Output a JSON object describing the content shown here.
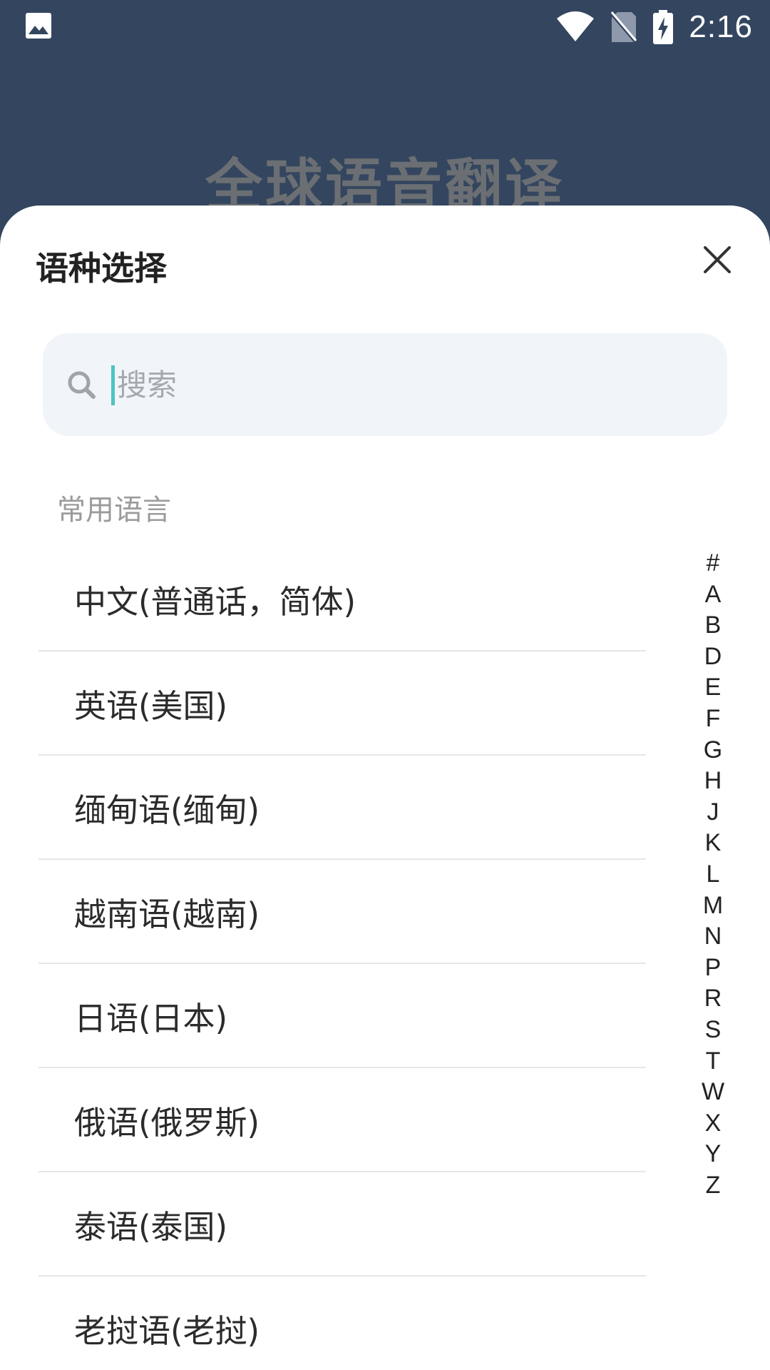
{
  "status_bar": {
    "time": "2:16",
    "icons": [
      "gallery-icon",
      "wifi-icon",
      "no-sim-icon",
      "battery-charging-icon"
    ]
  },
  "background": {
    "app_title": "全球语音翻译"
  },
  "sheet": {
    "title": "语种选择",
    "close_icon": "close-icon",
    "search": {
      "placeholder": "搜索",
      "value": "",
      "icon": "search-icon"
    },
    "section_header": "常用语言",
    "languages": [
      "中文(普通话，简体)",
      "英语(美国)",
      "缅甸语(缅甸)",
      "越南语(越南)",
      "日语(日本)",
      "俄语(俄罗斯)",
      "泰语(泰国)",
      "老挝语(老挝)"
    ],
    "index_letters": [
      "#",
      "A",
      "B",
      "D",
      "E",
      "F",
      "G",
      "H",
      "J",
      "K",
      "L",
      "M",
      "N",
      "P",
      "R",
      "S",
      "T",
      "W",
      "X",
      "Y",
      "Z"
    ]
  },
  "colors": {
    "header_background": "#34465f",
    "sheet_background": "#ffffff",
    "search_background": "#f1f4f9",
    "cursor_accent": "#4fc3c0"
  }
}
